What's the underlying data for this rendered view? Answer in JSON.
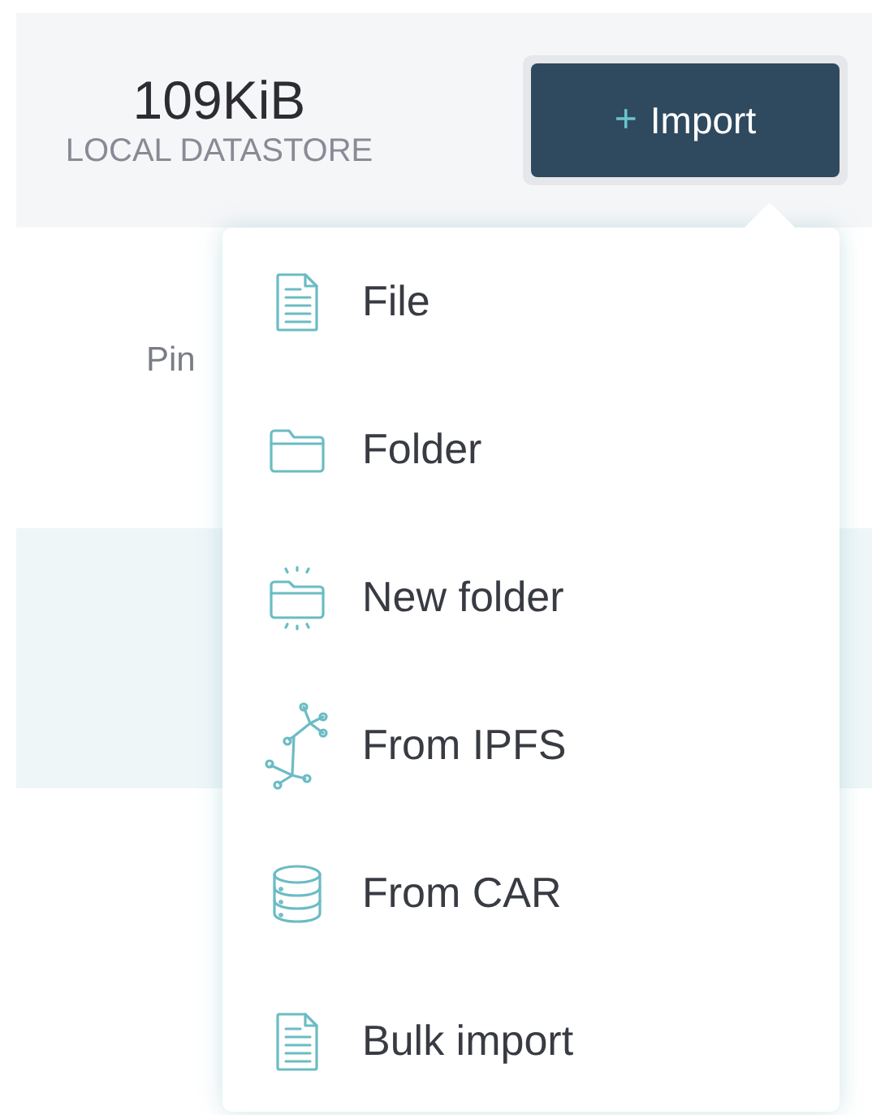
{
  "stats": {
    "size": "109KiB",
    "label": "LOCAL DATASTORE"
  },
  "import_button": {
    "plus": "+",
    "label": "Import"
  },
  "background_label": "Pin",
  "import_menu": {
    "items": [
      {
        "kind": "file",
        "label": "File"
      },
      {
        "kind": "folder",
        "label": "Folder"
      },
      {
        "kind": "new-folder",
        "label": "New folder"
      },
      {
        "kind": "ipfs",
        "label": "From IPFS"
      },
      {
        "kind": "car",
        "label": "From CAR"
      },
      {
        "kind": "file",
        "label": "Bulk import"
      }
    ]
  }
}
